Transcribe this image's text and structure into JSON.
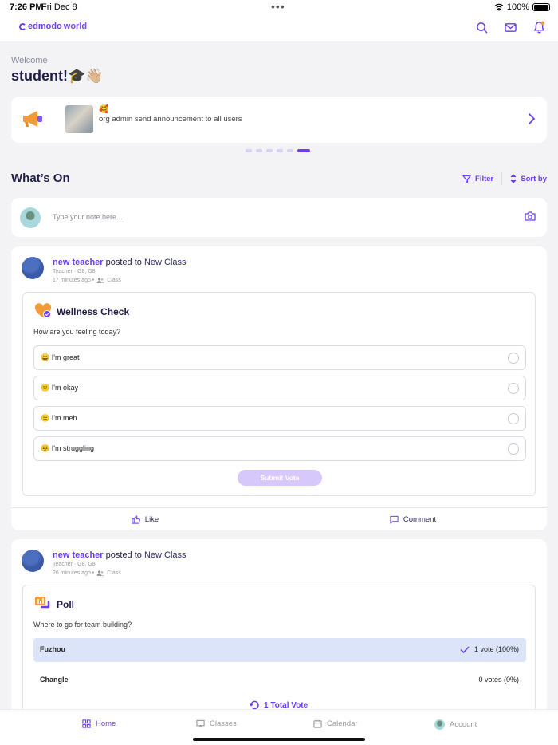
{
  "status": {
    "time": "7:26 PM",
    "date": "Fri Dec 8",
    "battery": "100%"
  },
  "brand": {
    "logo_a": "edmodo",
    "logo_b": "world"
  },
  "welcome": {
    "greeting": "Welcome",
    "name": "student!🎓👋🏼"
  },
  "announcement": {
    "emoji": "🥰",
    "text": "org admin send announcement to all users",
    "pager_count": 6,
    "pager_active": 5
  },
  "feed": {
    "title": "What’s On",
    "filter_label": "Filter",
    "sort_label": "Sort by"
  },
  "composer": {
    "placeholder": "Type your note here..."
  },
  "posts": [
    {
      "author": "new teacher",
      "verb": " posted to ",
      "class_name": "New Class",
      "subtitle": "Teacher · G8, G8",
      "time": "17 minutes ago •",
      "audience": "Class",
      "card": {
        "title": "Wellness Check",
        "question": "How are you feeling today?",
        "options": [
          {
            "emoji": "😀",
            "label": "I'm great"
          },
          {
            "emoji": "🙂",
            "label": "I'm okay"
          },
          {
            "emoji": "😐",
            "label": "I'm meh"
          },
          {
            "emoji": "😣",
            "label": "I'm struggling"
          }
        ],
        "submit_label": "Submit Vote"
      },
      "like_label": "Like",
      "comment_label": "Comment"
    },
    {
      "author": "new teacher",
      "verb": " posted to ",
      "class_name": "New Class",
      "subtitle": "Teacher · G8, G8",
      "time": "26 minutes ago •",
      "audience": "Class",
      "card": {
        "title": "Poll",
        "question": "Where to go for team building?",
        "results": [
          {
            "label": "Fuzhou",
            "votes": "1 vote (100%)",
            "fraction": 1.0,
            "selected": true
          },
          {
            "label": "Changle",
            "votes": "0 votes (0%)",
            "fraction": 0.0,
            "selected": false
          }
        ],
        "total": "1 Total Vote"
      }
    }
  ],
  "tabs": [
    {
      "label": "Home",
      "icon": "home-grid-icon",
      "active": true
    },
    {
      "label": "Classes",
      "icon": "classes-board-icon",
      "active": false
    },
    {
      "label": "Calendar",
      "icon": "calendar-icon",
      "active": false
    },
    {
      "label": "Account",
      "icon": "account-avatar-icon",
      "active": false
    }
  ],
  "colors": {
    "accent": "#6a3df0",
    "submit_disabled": "#d7c8fb",
    "poll_selected": "#dbe4f8",
    "background": "#f3f3f6"
  }
}
